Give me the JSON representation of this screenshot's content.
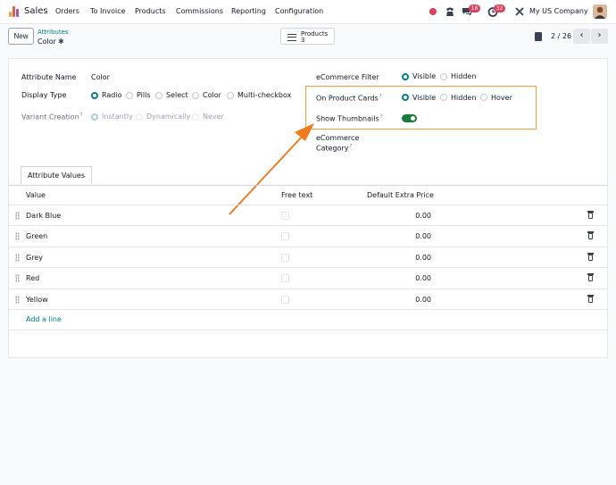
{
  "nav": {
    "app_name": "Sales",
    "menu": [
      "Orders",
      "To Invoice",
      "Products",
      "Commissions",
      "Reporting",
      "Configuration"
    ],
    "messages_count": "18",
    "activities_count": "32",
    "company": "My US Company"
  },
  "control_panel": {
    "new_label": "New",
    "breadcrumb_parent": "Attributes",
    "breadcrumb_current": "Color",
    "smart_button_label": "Products",
    "smart_button_count": "3",
    "pager": "2 / 26"
  },
  "form": {
    "attribute_name_label": "Attribute Name",
    "attribute_name_value": "Color",
    "display_type_label": "Display Type",
    "display_type_options": [
      "Radio",
      "Pills",
      "Select",
      "Color",
      "Multi-checkbox"
    ],
    "display_type_selected": "Radio",
    "variant_creation_label": "Variant Creation",
    "variant_creation_options": [
      "Instantly",
      "Dynamically",
      "Never"
    ],
    "variant_creation_selected": "Instantly",
    "ecommerce_filter_label": "eCommerce Filter",
    "ecommerce_filter_options": [
      "Visible",
      "Hidden"
    ],
    "ecommerce_filter_selected": "Visible",
    "product_cards_label": "On Product Cards",
    "product_cards_options": [
      "Visible",
      "Hidden",
      "Hover"
    ],
    "product_cards_selected": "Visible",
    "show_thumbnails_label": "Show Thumbnails",
    "show_thumbnails_value": true,
    "ecommerce_category_label_1": "eCommerce",
    "ecommerce_category_label_2": "Category",
    "tooltip_mark": "?"
  },
  "values_tab": {
    "tab_label": "Attribute Values",
    "columns": [
      "Value",
      "Free text",
      "Default Extra Price"
    ],
    "rows": [
      {
        "value": "Dark Blue",
        "price": "0.00"
      },
      {
        "value": "Green",
        "price": "0.00"
      },
      {
        "value": "Grey",
        "price": "0.00"
      },
      {
        "value": "Red",
        "price": "0.00"
      },
      {
        "value": "Yellow",
        "price": "0.00"
      }
    ],
    "add_line": "Add a line"
  },
  "colors": {
    "accent": "#017e84",
    "toggle_on": "#1a7a3a",
    "annotation": "#f07a1e",
    "badge": "#e0405c"
  }
}
